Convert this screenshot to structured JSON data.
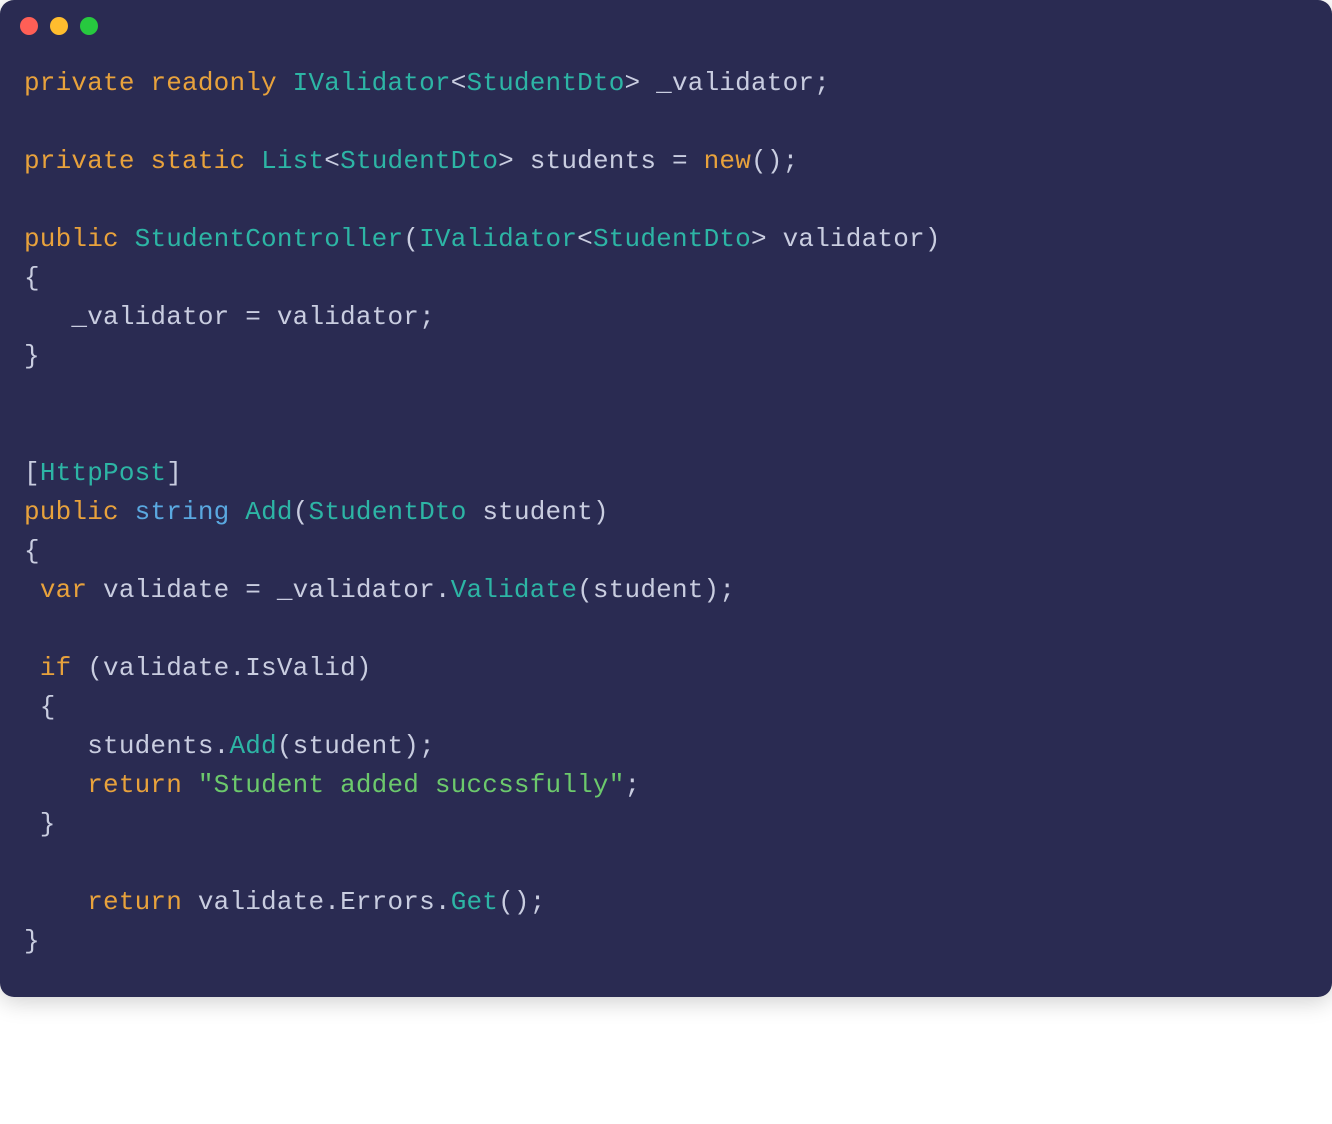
{
  "titlebar": {
    "buttons": [
      "close",
      "minimize",
      "zoom"
    ]
  },
  "code": {
    "l1": {
      "private": "private",
      "readonly": "readonly",
      "ivalidator": "IValidator",
      "lt": "<",
      "studentdto": "StudentDto",
      "gt": ">",
      "field": " _validator;"
    },
    "l2_blank": "",
    "l3": {
      "private": "private",
      "static": "static",
      "list": "List",
      "lt": "<",
      "studentdto": "StudentDto",
      "gt": ">",
      "students": " students ",
      "eq": "= ",
      "new": "new",
      "paren": "();"
    },
    "l4_blank": "",
    "l5": {
      "public": "public",
      "ctor": "StudentController",
      "open": "(",
      "ivalidator": "IValidator",
      "lt": "<",
      "studentdto": "StudentDto",
      "gt": ">",
      "param": " validator)"
    },
    "l6": "{",
    "l7": "   _validator = validator;",
    "l8": "}",
    "l9_blank": "",
    "l10_blank": "",
    "l11": {
      "open": "[",
      "attr": "HttpPost",
      "close": "]"
    },
    "l12": {
      "public": "public",
      "string": "string",
      "add": "Add",
      "open": "(",
      "studentdto": "StudentDto",
      "param": " student)"
    },
    "l13": "{",
    "l14": {
      "indent": " ",
      "var": "var",
      "validate": " validate ",
      "eq": "= _validator.",
      "method": "Validate",
      "args": "(student);"
    },
    "l15_blank": "",
    "l16": {
      "indent": " ",
      "if": "if",
      "cond": " (validate.IsValid)"
    },
    "l17": " {",
    "l18": {
      "indent": "    students.",
      "add": "Add",
      "args": "(student);"
    },
    "l19": {
      "indent": "    ",
      "return": "return",
      "sp": " ",
      "str": "\"Student added succssfully\"",
      "semi": ";"
    },
    "l20": " }",
    "l21_blank": "",
    "l22": {
      "indent": "    ",
      "return": "return",
      "rest": " validate.Errors.",
      "get": "Get",
      "paren": "();"
    },
    "l23": "}"
  }
}
